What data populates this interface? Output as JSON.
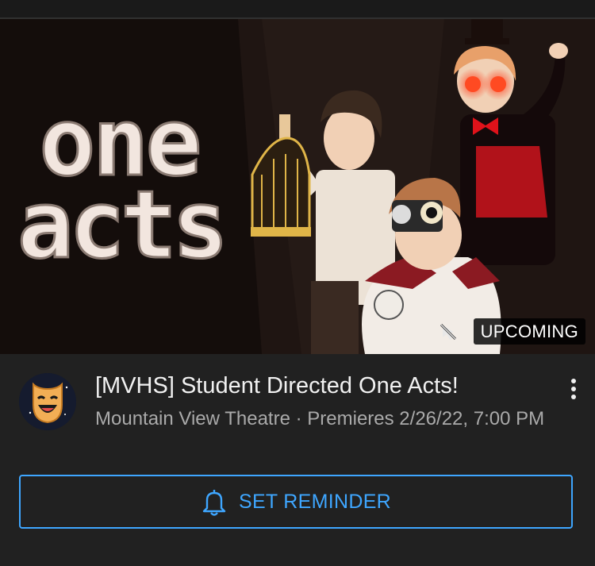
{
  "video": {
    "thumbnail_text_line1": "one",
    "thumbnail_text_line2": "acts",
    "badge": "UPCOMING",
    "title": "[MVHS] Student Directed One Acts!",
    "channel": "Mountain View Theatre",
    "separator": "·",
    "premiere": "Premieres 2/26/22, 7:00 PM"
  },
  "actions": {
    "reminder_label": "SET REMINDER",
    "more_icon": "more-vert-icon",
    "bell_icon": "bell-icon"
  },
  "colors": {
    "background": "#212121",
    "accent": "#3ea6ff",
    "secondary_text": "#aaaaaa"
  }
}
